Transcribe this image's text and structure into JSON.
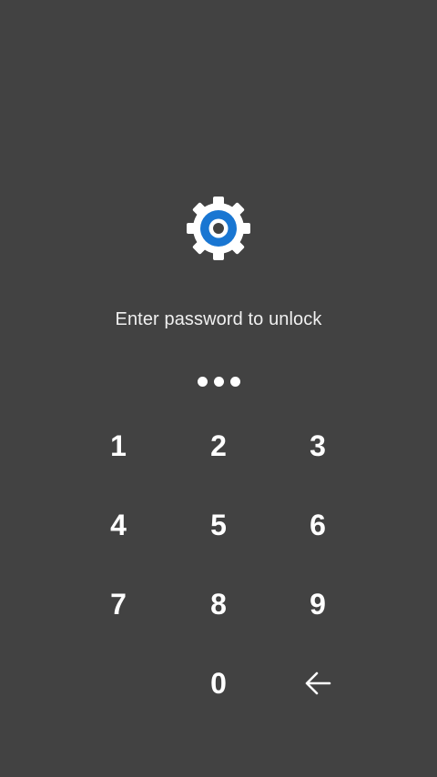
{
  "lock_screen": {
    "app_icon": "settings-gear-icon",
    "prompt": "Enter password to unlock",
    "entered_digits_count": 3
  },
  "keypad": {
    "keys": [
      "1",
      "2",
      "3",
      "4",
      "5",
      "6",
      "7",
      "8",
      "9",
      "0"
    ],
    "backspace_icon": "backspace-arrow-icon"
  },
  "colors": {
    "background": "#424242",
    "icon_blue": "#1976d2",
    "icon_gear": "#ffffff",
    "text": "#ffffff"
  }
}
